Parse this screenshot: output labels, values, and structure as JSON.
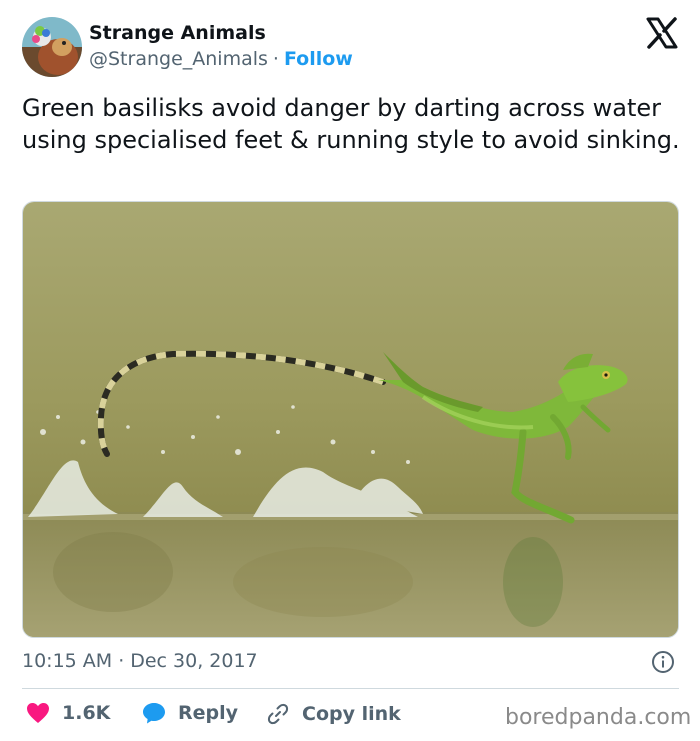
{
  "author": {
    "name": "Strange Animals",
    "handle": "@Strange_Animals",
    "separator": "·",
    "follow_label": "Follow"
  },
  "platform_icon": "x-logo-icon",
  "tweet": {
    "text": "Green basilisks avoid danger by darting across water using specialised feet & running style to avoid sinking."
  },
  "media": {
    "subject": "green basilisk lizard running across water"
  },
  "meta": {
    "time": "10:15 AM",
    "separator": "·",
    "date": "Dec 30, 2017",
    "info_icon": "info-icon"
  },
  "actions": {
    "likes": "1.6K",
    "reply_label": "Reply",
    "copy_link_label": "Copy link"
  },
  "watermark": "boredpanda.com",
  "colors": {
    "accent": "#1d9bf0",
    "like": "#f91880",
    "text": "#0f1419",
    "secondary": "#536471"
  }
}
